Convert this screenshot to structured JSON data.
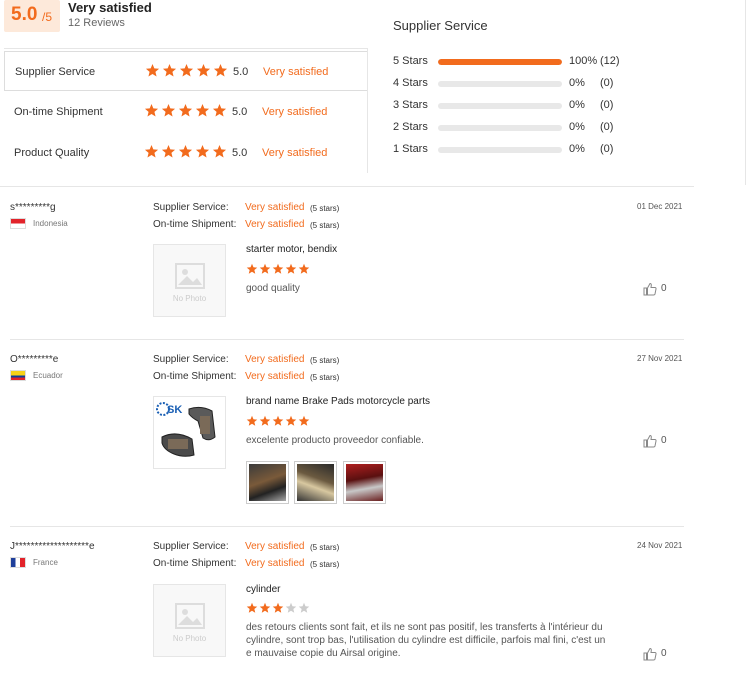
{
  "summary": {
    "score": "5.0",
    "score_max": "/5",
    "label": "Very satisfied",
    "reviews_count": "12 Reviews"
  },
  "ratings": [
    {
      "label": "Supplier Service",
      "stars": 5,
      "value": "5.0",
      "word": "Very satisfied"
    },
    {
      "label": "On-time Shipment",
      "stars": 5,
      "value": "5.0",
      "word": "Very satisfied"
    },
    {
      "label": "Product Quality",
      "stars": 5,
      "value": "5.0",
      "word": "Very satisfied"
    }
  ],
  "distribution": {
    "title": "Supplier Service",
    "rows": [
      {
        "label": "5 Stars",
        "fraction": 1.0,
        "pct": "100%",
        "count": "(12)"
      },
      {
        "label": "4 Stars",
        "fraction": 0,
        "pct": "0%",
        "count": "(0)"
      },
      {
        "label": "3 Stars",
        "fraction": 0,
        "pct": "0%",
        "count": "(0)"
      },
      {
        "label": "2 Stars",
        "fraction": 0,
        "pct": "0%",
        "count": "(0)"
      },
      {
        "label": "1 Stars",
        "fraction": 0,
        "pct": "0%",
        "count": "(0)"
      }
    ]
  },
  "reviews": [
    {
      "user": "s*********g",
      "country": "Indonesia",
      "supplier_label": "Supplier Service:",
      "supplier_value": "Very satisfied",
      "supplier_stars": "(5 stars)",
      "shipment_label": "On-time Shipment:",
      "shipment_value": "Very satisfied",
      "shipment_stars": "(5 stars)",
      "date": "01 Dec 2021",
      "no_photo": "No Photo",
      "product": "starter motor, bendix",
      "rating": 5,
      "comment": "good quality",
      "likes": "0"
    },
    {
      "user": "O*********e",
      "country": "Ecuador",
      "supplier_label": "Supplier Service:",
      "supplier_value": "Very satisfied",
      "supplier_stars": "(5 stars)",
      "shipment_label": "On-time Shipment:",
      "shipment_value": "Very satisfied",
      "shipment_stars": "(5 stars)",
      "date": "27 Nov 2021",
      "product": "brand name Brake Pads motorcycle parts",
      "rating": 5,
      "comment": "excelente producto proveedor confiable.",
      "likes": "0"
    },
    {
      "user": "J*******************e",
      "country": "France",
      "supplier_label": "Supplier Service:",
      "supplier_value": "Very satisfied",
      "supplier_stars": "(5 stars)",
      "shipment_label": "On-time Shipment:",
      "shipment_value": "Very satisfied",
      "shipment_stars": "(5 stars)",
      "date": "24 Nov 2021",
      "no_photo": "No Photo",
      "product": "cylinder",
      "rating": 3,
      "comment": "des retours clients sont fait, et ils ne sont pas positif, les transferts à l'intérieur du cylindre, sont trop bas, l'utilisation du cylindre est difficile, parfois mal fini, c'est un e mauvaise copie du Airsal origine.",
      "likes": "0"
    }
  ],
  "colors": {
    "accent": "#f26b1d",
    "star_empty": "#cccccc",
    "bar_bg": "#e8e8e8"
  }
}
